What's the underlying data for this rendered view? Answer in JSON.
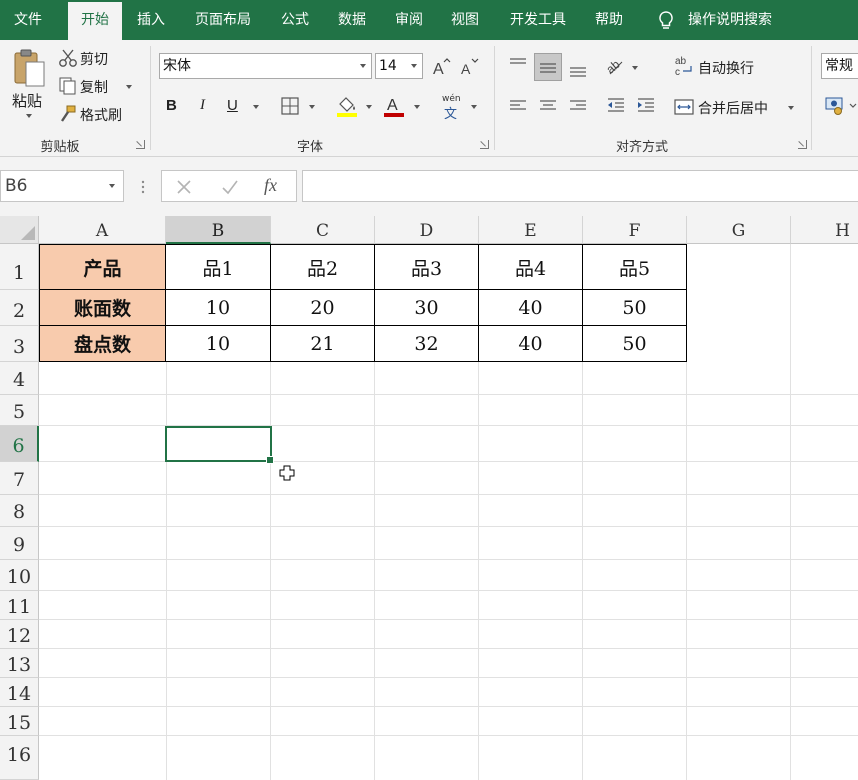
{
  "menu": {
    "tabs": [
      {
        "label": "文件",
        "active": false
      },
      {
        "label": "开始",
        "active": true
      },
      {
        "label": "插入",
        "active": false
      },
      {
        "label": "页面布局",
        "active": false
      },
      {
        "label": "公式",
        "active": false
      },
      {
        "label": "数据",
        "active": false
      },
      {
        "label": "审阅",
        "active": false
      },
      {
        "label": "视图",
        "active": false
      },
      {
        "label": "开发工具",
        "active": false
      },
      {
        "label": "帮助",
        "active": false
      }
    ],
    "tell_me": "操作说明搜索",
    "accent_color": "#217346"
  },
  "ribbon": {
    "clipboard": {
      "paste": "粘贴",
      "cut": "剪切",
      "copy": "复制",
      "format_painter": "格式刷",
      "group_label": "剪贴板"
    },
    "font": {
      "font_name": "宋体",
      "font_size": "14",
      "bold": "B",
      "italic": "I",
      "underline": "U",
      "phonetic_top": "wén",
      "phonetic_bottom": "文",
      "group_label": "字体"
    },
    "alignment": {
      "wrap_text": "自动换行",
      "merge_center": "合并后居中",
      "group_label": "对齐方式"
    },
    "number": {
      "format": "常规"
    }
  },
  "formula_bar": {
    "name_box": "B6",
    "formula": "",
    "fx_label": "fx"
  },
  "grid": {
    "columns": [
      "A",
      "B",
      "C",
      "D",
      "E",
      "F",
      "G",
      "H"
    ],
    "rows": [
      "1",
      "2",
      "3",
      "4",
      "5",
      "6",
      "7",
      "8",
      "9",
      "10",
      "11",
      "12",
      "13",
      "14",
      "15",
      "16"
    ],
    "selected_cell": "B6",
    "header_fill": "#f8cbad"
  },
  "table": {
    "headers": [
      "产品",
      "品1",
      "品2",
      "品3",
      "品4",
      "品5"
    ],
    "rows": [
      {
        "label": "账面数",
        "values": [
          "10",
          "20",
          "30",
          "40",
          "50"
        ]
      },
      {
        "label": "盘点数",
        "values": [
          "10",
          "21",
          "32",
          "40",
          "50"
        ]
      }
    ]
  }
}
